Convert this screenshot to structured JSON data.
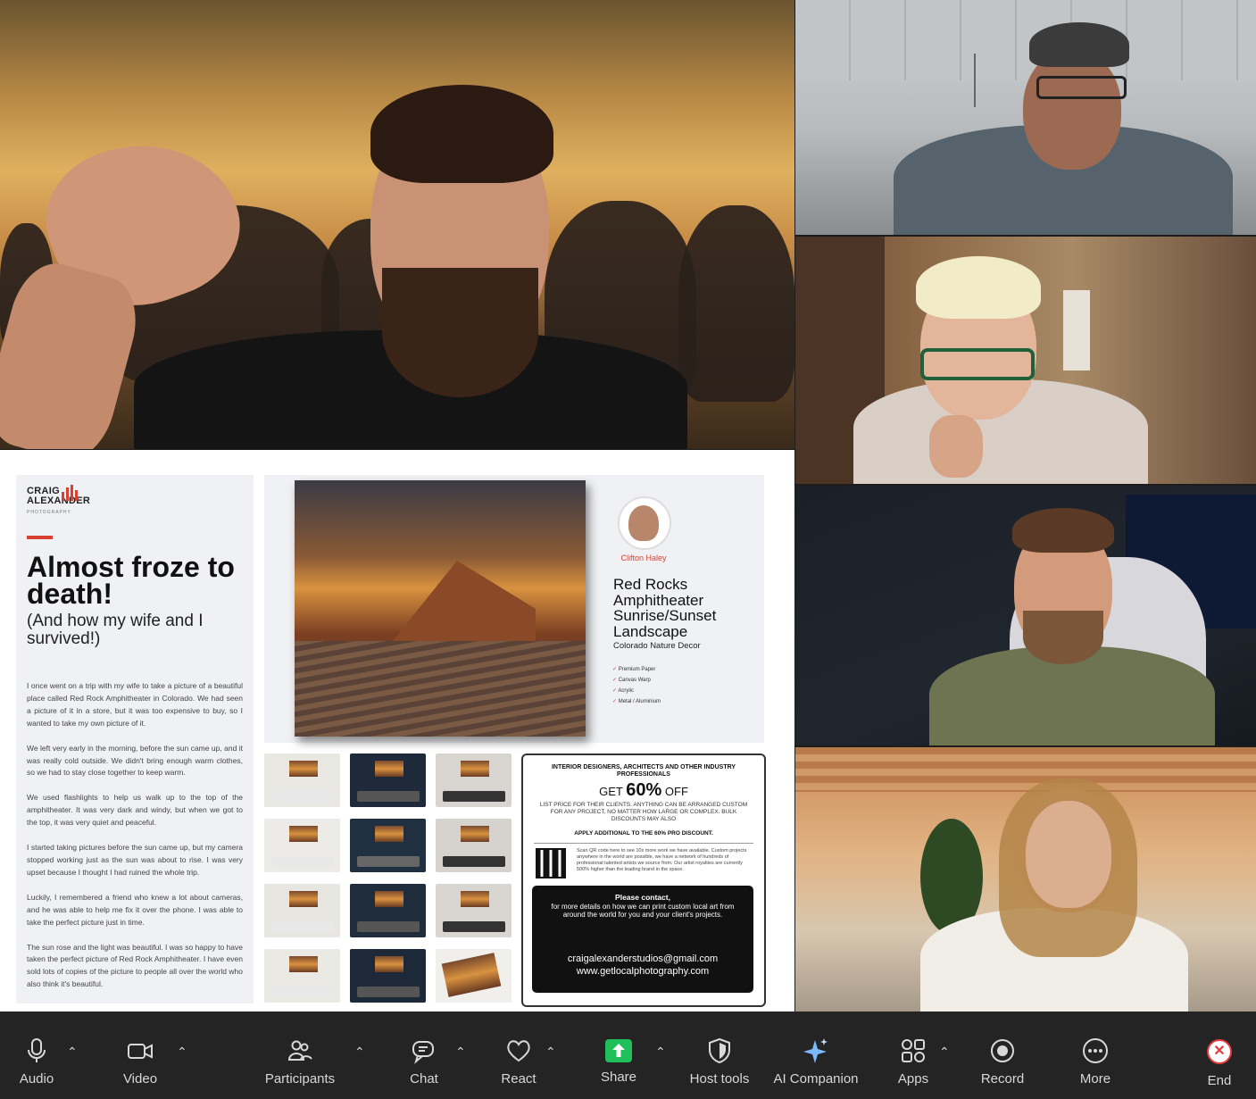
{
  "document": {
    "logo": {
      "line1": "CRAIG",
      "line2": "ALEXANDER",
      "line3": "PHOTOGRAPHY"
    },
    "headline": "Almost froze to death!",
    "subheadline": "(And how my wife and I survived!)",
    "paragraphs": [
      "I once went on a trip with my wife to take a picture of a beautiful place called Red Rock Amphitheater in Colorado. We had seen a picture of it in a store, but it was too expensive to buy, so I wanted to take my own picture of it.",
      "We left very early in the morning, before the sun came up, and it was really cold outside. We didn't bring enough warm clothes, so we had to stay close together to keep warm.",
      "We used flashlights to help us walk up to the top of the amphitheater. It was very dark and windy, but when we got to the top, it was very quiet and peaceful.",
      "I started taking pictures before the sun came up, but my camera stopped working just as the sun was about to rise. I was very upset because I thought I had ruined the whole trip.",
      "Luckily, I remembered a friend who knew a lot about cameras, and he was able to help me fix it over the phone. I was able to take the perfect picture just in time.",
      "The sun rose and the light was beautiful. I was so happy to have taken the perfect picture of Red Rock Amphitheater. I have even sold lots of copies of the picture to people all over the world who also think it's beautiful."
    ],
    "artist_name": "Clifton Haley",
    "product_title": "Red Rocks Amphitheater Sunrise/Sunset Landscape",
    "product_subtitle": "Colorado Nature Decor",
    "features": [
      "Premium Paper",
      "Canvas Warp",
      "Acrylic",
      "Metal / Aluminium"
    ],
    "promo": {
      "header": "INTERIOR DESIGNERS, ARCHITECTS AND OTHER INDUSTRY PROFESSIONALS",
      "get": "GET",
      "percent": "60%",
      "off": "OFF",
      "body": "LIST PRICE FOR THEIR CLIENTS. ANYTHING CAN BE ARRANGED CUSTOM FOR ANY PROJECT, NO MATTER HOW LARGE OR COMPLEX. BULK DISCOUNTS MAY ALSO",
      "apply": "APPLY ADDITIONAL TO THE 60% PRO DISCOUNT.",
      "qr_text": "Scan QR code here to see 10x more work we have available. Custom projects anywhere in the world are possible, we have a network of hundreds of professional talented artists we source from. Our artist royalties are currently 500% higher than the leading brand in the space.",
      "contact_title": "Please contact,",
      "contact_body": "for more details on how we can print custom local art from around the world for you and your client's projects.",
      "email": "craigalexanderstudios@gmail.com",
      "website": "www.getlocalphotography.com"
    }
  },
  "toolbar": {
    "audio": "Audio",
    "video": "Video",
    "participants": "Participants",
    "chat": "Chat",
    "react": "React",
    "share": "Share",
    "host_tools": "Host tools",
    "ai_companion": "AI Companion",
    "apps": "Apps",
    "record": "Record",
    "more": "More",
    "end": "End"
  },
  "colors": {
    "accent_red": "#d8412f",
    "share_green": "#1fbf5a",
    "toolbar_bg": "#242424",
    "end_red": "#e23c3c"
  }
}
